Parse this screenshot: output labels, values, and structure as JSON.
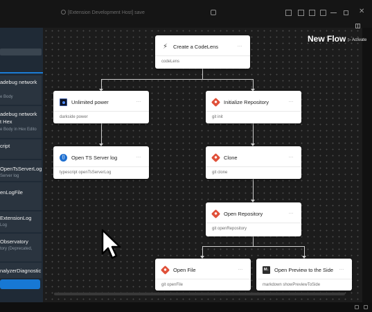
{
  "window": {
    "title": "[Extension Development Host] save"
  },
  "sidebar": {
    "items": [
      {
        "title": "adebug network",
        "subtitle": "e Body"
      },
      {
        "title": "adebug network",
        "title2": "t Hex",
        "subtitle": "e Body in Hex Edito"
      },
      {
        "title": "cript",
        "subtitle": ""
      },
      {
        "title": "OpenTsServerLog",
        "subtitle": "Server log"
      },
      {
        "title": "enLogFile",
        "subtitle": ""
      },
      {
        "title": "ExtensionLog",
        "subtitle": "Log"
      },
      {
        "title": "Observatory",
        "subtitle": "tory (Deprecated,"
      },
      {
        "title": "nalyzerDiagnostic",
        "subtitle": ""
      }
    ]
  },
  "header": {
    "flow_title": "New Flow",
    "activate_label": "Activate"
  },
  "nodes": {
    "codelens": {
      "label": "Create a CodeLens",
      "command": "codeLens",
      "icon": "lightning-icon"
    },
    "unlimited": {
      "label": "Unlimited power",
      "command": "darkside power",
      "icon": "darkside-icon"
    },
    "init_repo": {
      "label": "Initialize Repository",
      "command": "git init",
      "icon": "git-icon"
    },
    "ts_log": {
      "label": "Open TS Server log",
      "command": "typescript openTsServerLog",
      "icon": "typescript-icon"
    },
    "clone": {
      "label": "Clone",
      "command": "git clone",
      "icon": "git-icon"
    },
    "open_repo": {
      "label": "Open Repository",
      "command": "git openRepository",
      "icon": "git-icon"
    },
    "open_file": {
      "label": "Open File",
      "command": "git openFile",
      "icon": "git-icon"
    },
    "preview": {
      "label": "Open Preview to the Side",
      "command": "markdown showPreviewToSide",
      "icon": "markdown-icon"
    }
  },
  "colors": {
    "accent": "#1778d4",
    "git": "#e0513a",
    "canvas": "#1c1c1c",
    "node": "#ffffff"
  }
}
